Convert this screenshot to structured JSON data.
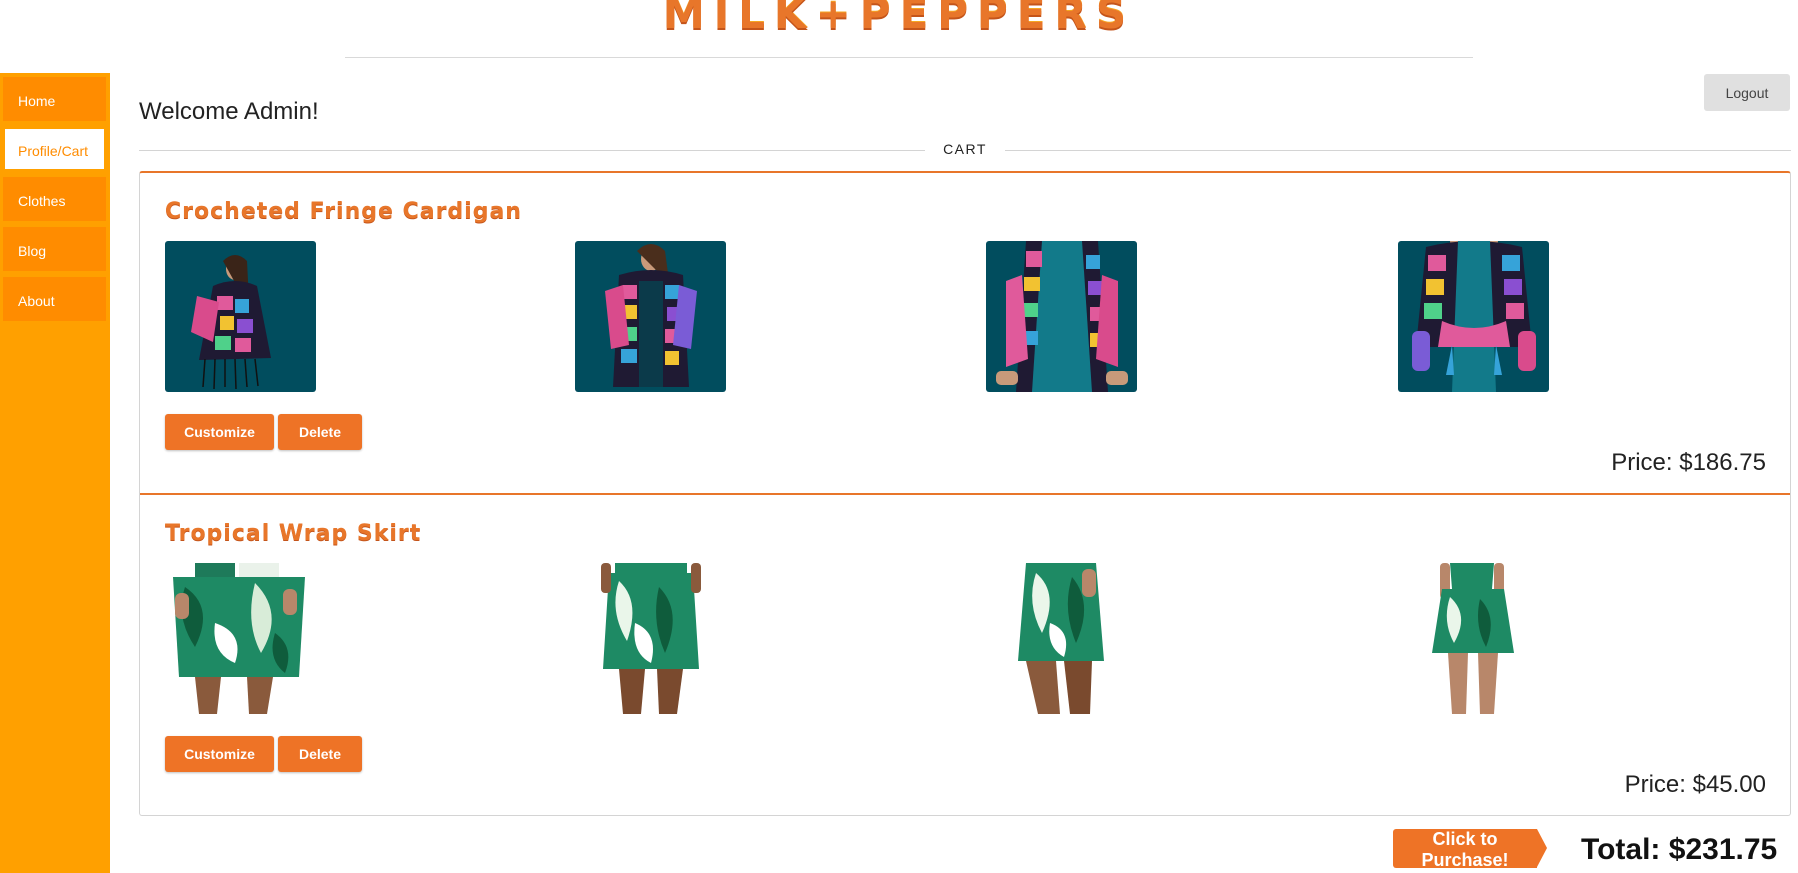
{
  "brand": {
    "title": "MILK+PEPPERS"
  },
  "sidebar": {
    "items": [
      {
        "label": "Home"
      },
      {
        "label": "Profile/Cart"
      },
      {
        "label": "Clothes"
      },
      {
        "label": "Blog"
      },
      {
        "label": "About"
      }
    ]
  },
  "header": {
    "logout_label": "Logout",
    "welcome": "Welcome Admin!"
  },
  "cart": {
    "section_label": "CART",
    "items": [
      {
        "title": "Crocheted Fringe Cardigan",
        "customize_label": "Customize",
        "delete_label": "Delete",
        "price": "Price: $186.75"
      },
      {
        "title": "Tropical Wrap Skirt",
        "customize_label": "Customize",
        "delete_label": "Delete",
        "price": "Price: $45.00"
      }
    ],
    "purchase_label": "Click to Purchase!",
    "total": "Total: $231.75"
  },
  "colors": {
    "accent": "#ee7326",
    "sidebar": "#ffa000",
    "nav": "#ff8c00",
    "photo_bg": "#014d5e"
  }
}
